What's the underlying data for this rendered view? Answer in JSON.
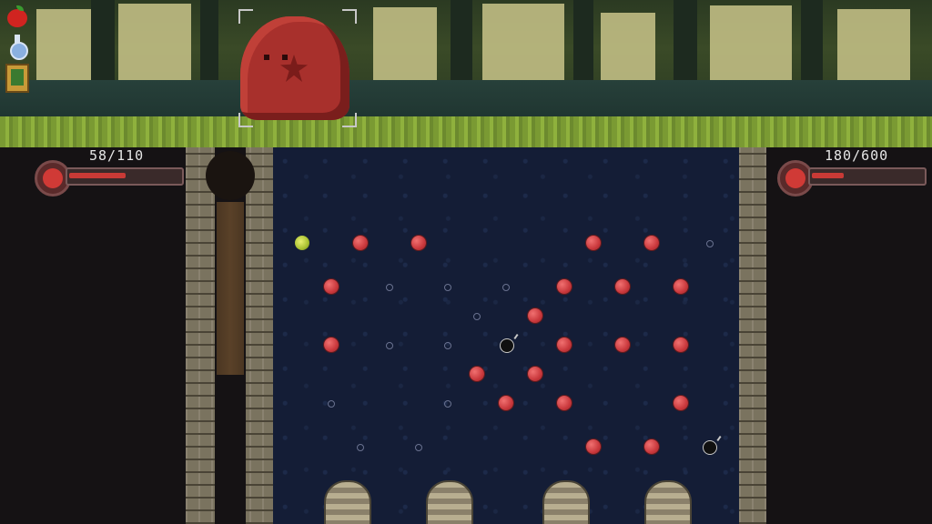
{
  "player": {
    "hp_text": "58/110",
    "hp_current": 58,
    "hp_max": 110
  },
  "enemy": {
    "name_icon": "slime-face-icon",
    "hp_text": "180/600",
    "hp_current": 180,
    "hp_max": 600
  },
  "relics": [
    "apple-icon",
    "potion-icon",
    "spellbook-icon"
  ],
  "colors": {
    "peg_red": "#c9383c",
    "ball_yellow": "#a8c030",
    "board": "#141d36",
    "grass": "#8fb13d",
    "slime": "#a8302c"
  }
}
